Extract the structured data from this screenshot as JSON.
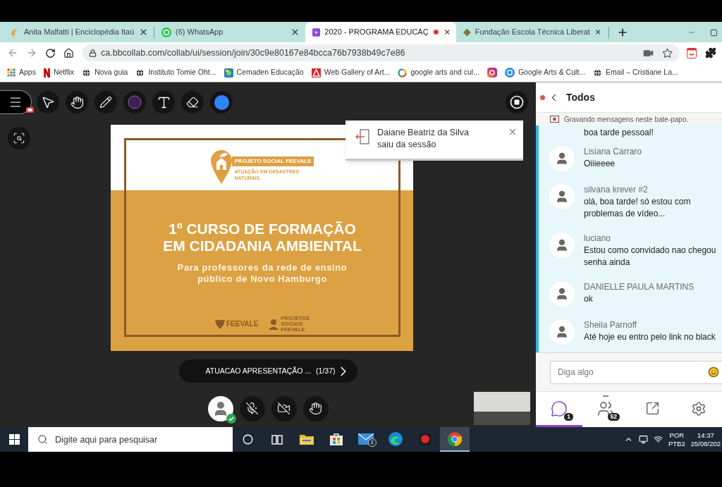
{
  "browser": {
    "tabs": [
      {
        "title": "Anita Malfatti | Enciclopédia Itaú",
        "selected": false,
        "recording": false
      },
      {
        "title": "(6) WhatsApp",
        "selected": false,
        "recording": false
      },
      {
        "title": "2020 - PROGRAMA EDUCAÇ",
        "selected": true,
        "recording": true
      },
      {
        "title": "Fundação Escola Técnica Liberat",
        "selected": false,
        "recording": false
      }
    ],
    "address": "ca.bbcollab.com/collab/ui/session/join/30c9e80167e84bcca76b7938b49c7e86",
    "bookmarks": [
      {
        "kind": "labeled",
        "label": "Apps"
      },
      {
        "kind": "labeled",
        "label": "Netflix"
      },
      {
        "kind": "labeled",
        "label": "Nova guia"
      },
      {
        "kind": "labeled",
        "label": "Instituto Tomie Oht..."
      },
      {
        "kind": "labeled",
        "label": "Cemaden Educação"
      },
      {
        "kind": "labeled",
        "label": "Web Gallery of Art..."
      },
      {
        "kind": "labeled",
        "label": "google arts and cul..."
      },
      {
        "kind": "icon"
      },
      {
        "kind": "labeled",
        "label": "Google Arts & Cult..."
      },
      {
        "kind": "labeled",
        "label": "Email – Cristiane La..."
      }
    ]
  },
  "app": {
    "recording": true,
    "slide": {
      "logo_title": "PROJETO SOCIAL FEEVALE",
      "logo_subtitle": "ATUAÇÃO EM DESASTRES\nNATURAIS",
      "title": "1º CURSO DE FORMAÇÃO\nEM CIDADANIA AMBIENTAL",
      "subtitle": "Para professores da rede de ensino\npúblico de Novo Hamburgo",
      "footer_logos": [
        "FEEVALE",
        "PROJETOS\nSOCIAIS\nFEEVALE"
      ]
    },
    "notification": {
      "message": "Daiane Beatriz da Silva\nsaiu da sessão"
    },
    "presentation": {
      "title": "ATUACAO APRESENTAÇÃO ...",
      "page": "(1/37)"
    },
    "media": {
      "mic_on": false,
      "camera_on": false
    }
  },
  "chat": {
    "title": "Todos",
    "recording_notice": "Gravando mensagens neste bate-papo.",
    "previous_text": "boa tarde pessoal!",
    "messages": [
      {
        "author": "Lisiana Carraro",
        "text": "Oiiieeee"
      },
      {
        "author": "silvana krever #2",
        "text": "olá, boa tarde! só estou com problemas de vídeo..."
      },
      {
        "author": "luciano",
        "text": "Estou como convidado nao chegou senha ainda"
      },
      {
        "author": "DANIELLE PAULA MARTINS",
        "text": "ok"
      },
      {
        "author": "Sheila Parnoff",
        "text": "Até hoje eu entro pelo link no black"
      }
    ],
    "input": {
      "placeholder": "Diga algo"
    },
    "tabs": [
      {
        "selected": true,
        "badge": "1"
      },
      {
        "selected": false,
        "badge": "52"
      },
      {
        "selected": false
      },
      {
        "selected": false
      }
    ]
  },
  "taskbar": {
    "search": {
      "placeholder": "Digite aqui para pesquisar"
    },
    "apps": [
      {
        "active": false
      },
      {
        "active": false
      },
      {
        "active": false,
        "badge": "2"
      },
      {
        "active": false
      },
      {
        "active": false
      },
      {
        "active": true
      }
    ],
    "language": "POR",
    "layout": "PTB2",
    "time": "14:37",
    "date": "25/08/202"
  }
}
